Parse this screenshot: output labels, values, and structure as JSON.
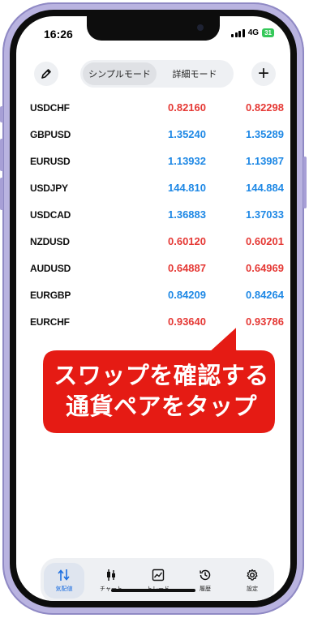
{
  "status": {
    "time": "16:26",
    "network": "4G",
    "battery": "31"
  },
  "header": {
    "modes": [
      "シンプルモード",
      "詳細モード"
    ],
    "add_label": "+"
  },
  "quotes": [
    {
      "symbol": "USDCHF",
      "bid": "0.82160",
      "ask": "0.82298",
      "dir": "down"
    },
    {
      "symbol": "GBPUSD",
      "bid": "1.35240",
      "ask": "1.35289",
      "dir": "up"
    },
    {
      "symbol": "EURUSD",
      "bid": "1.13932",
      "ask": "1.13987",
      "dir": "up"
    },
    {
      "symbol": "USDJPY",
      "bid": "144.810",
      "ask": "144.884",
      "dir": "up"
    },
    {
      "symbol": "USDCAD",
      "bid": "1.36883",
      "ask": "1.37033",
      "dir": "up"
    },
    {
      "symbol": "NZDUSD",
      "bid": "0.60120",
      "ask": "0.60201",
      "dir": "down"
    },
    {
      "symbol": "AUDUSD",
      "bid": "0.64887",
      "ask": "0.64969",
      "dir": "down"
    },
    {
      "symbol": "EURGBP",
      "bid": "0.84209",
      "ask": "0.84264",
      "dir": "up"
    },
    {
      "symbol": "EURCHF",
      "bid": "0.93640",
      "ask": "0.93786",
      "dir": "down"
    }
  ],
  "callout": {
    "line1": "スワップを確認する",
    "line2": "通貨ペアをタップ"
  },
  "tabs": [
    {
      "label": "気配値",
      "icon": "arrows-updown-icon",
      "active": true
    },
    {
      "label": "チャート",
      "icon": "candlestick-icon",
      "active": false
    },
    {
      "label": "トレード",
      "icon": "trade-chart-icon",
      "active": false
    },
    {
      "label": "履歴",
      "icon": "history-icon",
      "active": false
    },
    {
      "label": "設定",
      "icon": "gear-icon",
      "active": false
    }
  ],
  "colors": {
    "down": "#e53935",
    "up": "#1e88e5",
    "callout": "#e51b14",
    "frame": "#b9b3e0"
  }
}
